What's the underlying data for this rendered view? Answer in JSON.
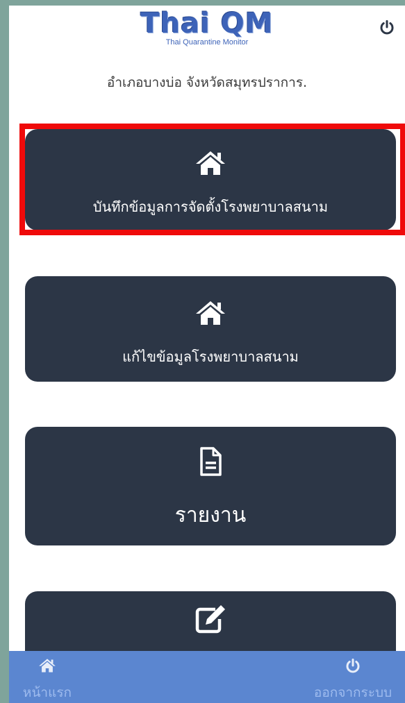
{
  "header": {
    "logo_title": "Thai QM",
    "logo_subtitle": "Thai Quarantine Monitor",
    "power_icon": "power-icon"
  },
  "location_text": "อำเภอบางบ่อ จังหวัดสมุทรปราการ.",
  "menu": [
    {
      "icon": "home-icon",
      "label": "บันทึกข้อมูลการจัดตั้งโรงพยาบาลสนาม",
      "highlighted": true
    },
    {
      "icon": "home-icon",
      "label": "แก้ไขข้อมูลโรงพยาบาลสนาม"
    },
    {
      "icon": "document-icon",
      "label": "รายงาน"
    },
    {
      "icon": "edit-icon",
      "label": ""
    }
  ],
  "bottom_nav": {
    "home_label": "หน้าแรก",
    "logout_label": "ออกจากระบบ"
  },
  "colors": {
    "card_bg": "#2c3646",
    "nav_bg": "#5b86d0",
    "highlight": "#ef0a0a",
    "logo": "#3d63b8"
  }
}
